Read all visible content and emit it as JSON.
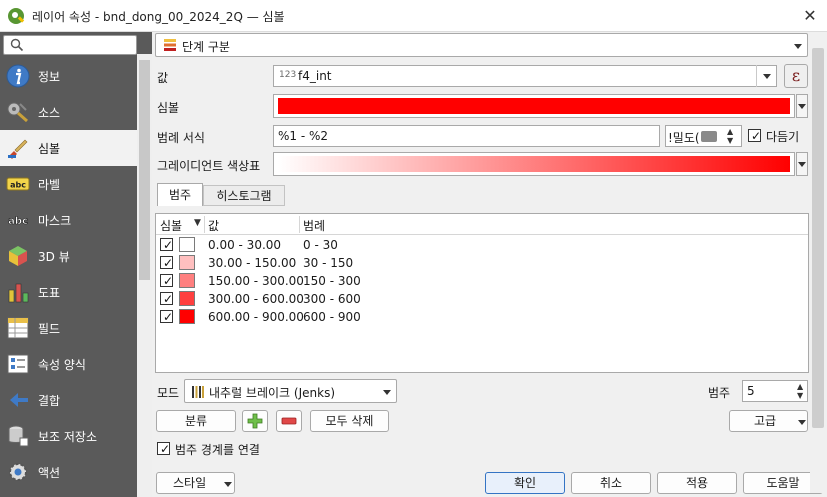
{
  "window": {
    "title": "레이어 속성 - bnd_dong_00_2024_2Q — 심볼",
    "close_glyph": "✕"
  },
  "sidebar": {
    "search_placeholder": "",
    "items": [
      {
        "label": "정보",
        "icon": "info-icon"
      },
      {
        "label": "소스",
        "icon": "source-icon"
      },
      {
        "label": "심볼",
        "icon": "paintbrush-icon",
        "active": true
      },
      {
        "label": "라벨",
        "icon": "labels-abc-icon"
      },
      {
        "label": "마스크",
        "icon": "mask-abc-icon"
      },
      {
        "label": "3D 뷰",
        "icon": "cube-3d-icon"
      },
      {
        "label": "도표",
        "icon": "diagram-icon"
      },
      {
        "label": "필드",
        "icon": "fields-icon"
      },
      {
        "label": "속성 양식",
        "icon": "attributes-form-icon"
      },
      {
        "label": "결합",
        "icon": "joins-icon"
      },
      {
        "label": "보조 저장소",
        "icon": "auxiliary-storage-icon"
      },
      {
        "label": "액션",
        "icon": "actions-gear-icon"
      }
    ]
  },
  "renderer": {
    "label": "단계 구분"
  },
  "form": {
    "value_label": "값",
    "value_prefix": "123",
    "value": "f4_int",
    "expression_glyph": "ε",
    "symbol_label": "심볼",
    "symbol_color": "#ff0000",
    "legend_format_label": "범례 서식",
    "legend_format": "%1 - %2",
    "precision_text": "!밀도(",
    "trim_label": "다듬기",
    "trim_checked": true,
    "ramp_label": "그레이디언트 색상표",
    "ramp_start": "#ffffff",
    "ramp_end": "#ff0000"
  },
  "tabs": {
    "classes": "범주",
    "histogram": "히스토그램"
  },
  "table": {
    "headers": {
      "symbol": "심볼",
      "values": "값",
      "legend": "범례"
    },
    "rows": [
      {
        "checked": true,
        "color": "#ffffff",
        "value": "0.00 - 30.00",
        "legend": "0 - 30"
      },
      {
        "checked": true,
        "color": "#ffbfbf",
        "value": "30.00 - 150.00",
        "legend": "30 - 150"
      },
      {
        "checked": true,
        "color": "#ff7f7f",
        "value": "150.00 - 300.00",
        "legend": "150 - 300"
      },
      {
        "checked": true,
        "color": "#ff3f3f",
        "value": "300.00 - 600.00",
        "legend": "300 - 600"
      },
      {
        "checked": true,
        "color": "#ff0000",
        "value": "600.00 - 900.00",
        "legend": "600 - 900"
      }
    ]
  },
  "mode": {
    "label": "모드",
    "value": "내추럴 브레이크 (Jenks)"
  },
  "classes": {
    "label": "범주",
    "count": "5"
  },
  "buttons": {
    "classify": "분류",
    "delete_all": "모두 삭제",
    "advanced": "고급",
    "style": "스타일",
    "ok": "확인",
    "cancel": "취소",
    "apply": "적용",
    "help": "도움말"
  },
  "link_boundaries": {
    "label": "범주 경계를 연결",
    "checked": true
  }
}
